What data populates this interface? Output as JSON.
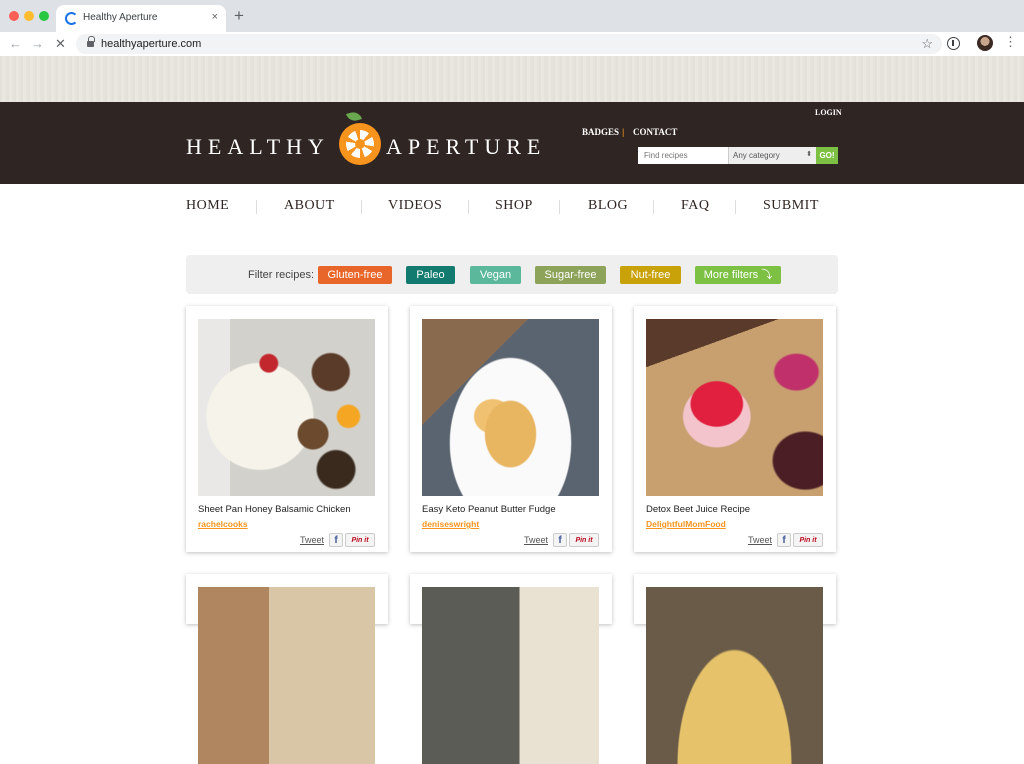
{
  "browser": {
    "tab_title": "Healthy Aperture",
    "tab_close": "×",
    "new_tab": "+",
    "url": "healthyaperture.com",
    "back_icon": "←",
    "forward_icon": "→",
    "stop_icon": "✕",
    "star_icon": "☆",
    "menu_icon": "⋮"
  },
  "header": {
    "logo_left": "HEALTHY",
    "logo_right": "APERTURE",
    "login": "LOGIN",
    "badges": "BADGES",
    "separator": "|",
    "contact": "CONTACT",
    "search_placeholder": "Find recipes",
    "category": "Any category",
    "category_arrow": "⬍",
    "go": "GO!"
  },
  "nav": {
    "items": [
      "HOME",
      "ABOUT",
      "VIDEOS",
      "SHOP",
      "BLOG",
      "FAQ",
      "SUBMIT"
    ]
  },
  "filters": {
    "label": "Filter recipes:",
    "chips": [
      {
        "label": "Gluten-free",
        "color": "#e8662a"
      },
      {
        "label": "Paleo",
        "color": "#137a6f"
      },
      {
        "label": "Vegan",
        "color": "#5bb89a"
      },
      {
        "label": "Sugar-free",
        "color": "#8ea35a"
      },
      {
        "label": "Nut-free",
        "color": "#c9a20a"
      },
      {
        "label": "More filters ⤵",
        "color": "#7cc143"
      }
    ]
  },
  "recipes": [
    {
      "title": "Sheet Pan Honey Balsamic Chicken",
      "author": "rachelcooks",
      "tweet": "Tweet",
      "fb": "f",
      "pin": "Pin it"
    },
    {
      "title": "Easy Keto Peanut Butter Fudge",
      "author": "deniseswright",
      "tweet": "Tweet",
      "fb": "f",
      "pin": "Pin it"
    },
    {
      "title": "Detox Beet Juice Recipe",
      "author": "DelightfulMomFood",
      "tweet": "Tweet",
      "fb": "f",
      "pin": "Pin it"
    }
  ],
  "colors": {
    "header_bg": "#2f2522",
    "brand_orange": "#f7941d",
    "go_green": "#7cc143"
  }
}
